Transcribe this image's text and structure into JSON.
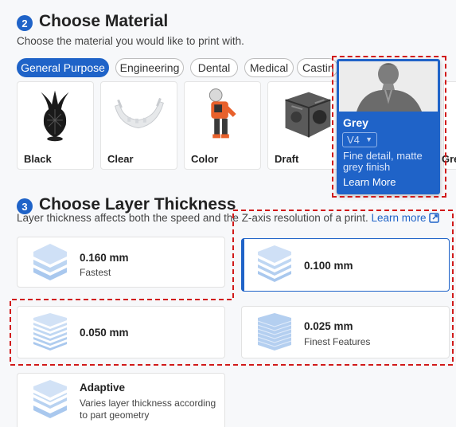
{
  "material": {
    "step": "2",
    "title": "Choose Material",
    "description": "Choose the material you would like to print with.",
    "tabs": [
      "General Purpose",
      "Engineering",
      "Dental",
      "Medical",
      "Castin"
    ],
    "active_tab": "General Purpose",
    "cards": [
      {
        "label": "Black"
      },
      {
        "label": "Clear"
      },
      {
        "label": "Color"
      },
      {
        "label": "Draft"
      },
      {
        "label": "Gre"
      }
    ],
    "popover": {
      "name": "Grey",
      "version": "V4",
      "description": "Fine detail, matte grey finish",
      "link": "Learn More"
    }
  },
  "thickness": {
    "step": "3",
    "title": "Choose Layer Thickness",
    "description": "Layer thickness affects both the speed and the Z-axis resolution of a print.",
    "learn_more": "Learn more",
    "options": [
      {
        "value": "0.160 mm",
        "subtitle": "Fastest"
      },
      {
        "value": "0.100 mm",
        "subtitle": ""
      },
      {
        "value": "0.050 mm",
        "subtitle": ""
      },
      {
        "value": "0.025 mm",
        "subtitle": "Finest Features"
      },
      {
        "value": "Adaptive",
        "subtitle": "Varies layer thickness according to part geometry"
      }
    ],
    "selected": "0.100 mm"
  },
  "colors": {
    "accent": "#1f63c8",
    "highlight_dash": "#d11a1a"
  }
}
